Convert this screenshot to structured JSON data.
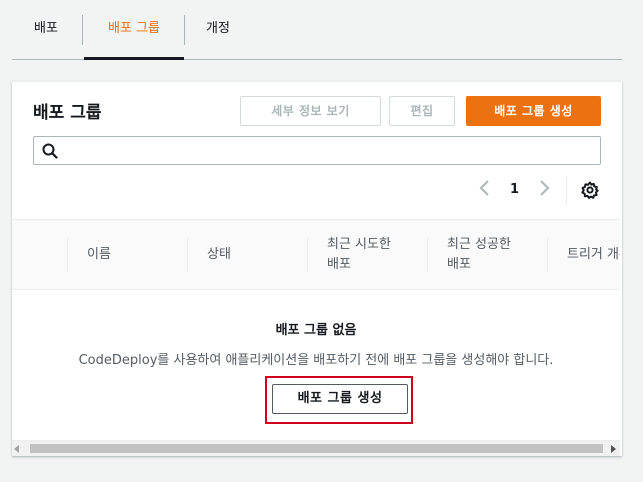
{
  "tabs": [
    {
      "label": "배포"
    },
    {
      "label": "배포 그룹"
    },
    {
      "label": "개정"
    }
  ],
  "panel": {
    "title": "배포 그룹",
    "buttons": {
      "view_details": "세부 정보 보기",
      "edit": "편집",
      "create": "배포 그룹 생성"
    },
    "search": {
      "placeholder": "",
      "value": ""
    },
    "pagination": {
      "current_page": "1"
    }
  },
  "table": {
    "columns": [
      "이름",
      "상태",
      "최근 시도한 배포",
      "최근 성공한 배포",
      "트리거 개수"
    ]
  },
  "empty_state": {
    "title": "배포 그룹 없음",
    "description": "CodeDeploy를 사용하여 애플리케이션을 배포하기 전에 배포 그룹을 생성해야 합니다.",
    "button": "배포 그룹 생성"
  },
  "colors": {
    "accent": "#ec7211",
    "highlight": "#d0021b"
  }
}
